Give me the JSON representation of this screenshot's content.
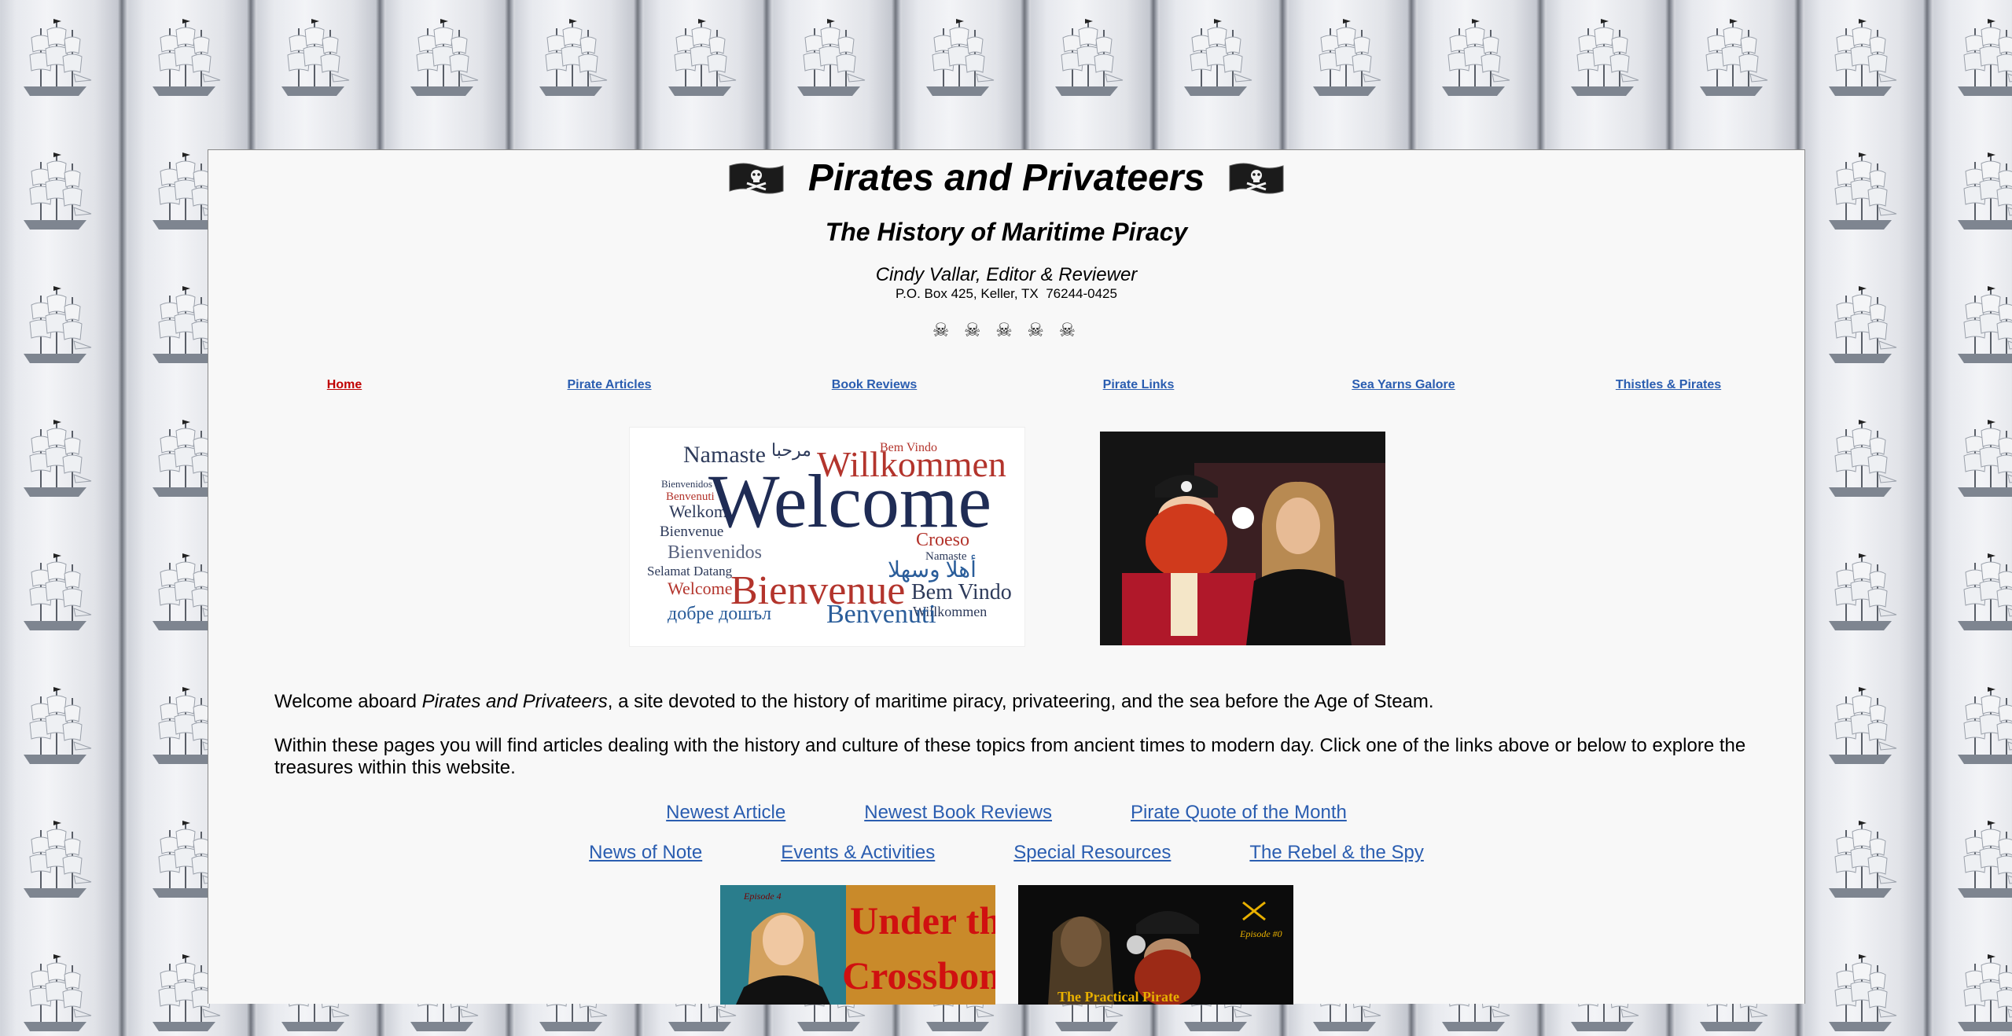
{
  "header": {
    "title": "Pirates and Privateers",
    "subtitle": "The History of Maritime Piracy",
    "editor": "Cindy Vallar, Editor & Reviewer",
    "address": "P.O. Box 425, Keller, TX  76244-0425",
    "divider": "☠ ☠ ☠ ☠ ☠"
  },
  "nav": {
    "items": [
      {
        "label": "Home"
      },
      {
        "label": "Pirate Articles"
      },
      {
        "label": "Book Reviews"
      },
      {
        "label": "Pirate Links"
      },
      {
        "label": "Sea Yarns Galore"
      },
      {
        "label": "Thistles & Pirates"
      }
    ]
  },
  "welcome_cloud": {
    "words": [
      "Namaste",
      "مرحبا",
      "Willkommen",
      "Bem Vindo",
      "Bienvenidos",
      "Benvenuti",
      "Welkom",
      "Bienvenue",
      "Welcome",
      "Croeso",
      "Bienvenidos",
      "Selamat Datang",
      "Namaste",
      "أهلا وسهلا",
      "Welcome",
      "Bienvenue",
      "Bem Vindo",
      "Willkommen",
      "добре дошъл",
      "Benvenuti"
    ]
  },
  "intro": {
    "p1_before": "Welcome aboard ",
    "p1_italic": "Pirates and Privateers",
    "p1_after": ", a site devoted to the history of maritime piracy, privateering, and the sea before the Age of Steam.",
    "p2": "Within these pages you will find articles dealing with the history and culture of these topics from ancient times to modern day. Click one of the links above or below to explore the treasures within this website."
  },
  "links": {
    "row1": [
      {
        "label": "Newest Article"
      },
      {
        "label": "Newest Book Reviews"
      },
      {
        "label": "Pirate Quote of the Month"
      }
    ],
    "row2": [
      {
        "label": "News of Note"
      },
      {
        "label": "Events & Activities"
      },
      {
        "label": "Special Resources"
      },
      {
        "label": "The Rebel & the Spy"
      }
    ]
  },
  "thumbs": {
    "left_title": "Under the Crossbones",
    "left_episode": "Episode 4",
    "right_episode": "Episode #0",
    "right_caption": "The Practical Pirate"
  },
  "colors": {
    "nav_current": "#c00000",
    "link": "#2a5db0",
    "page_bg": "#f8f8f8"
  }
}
